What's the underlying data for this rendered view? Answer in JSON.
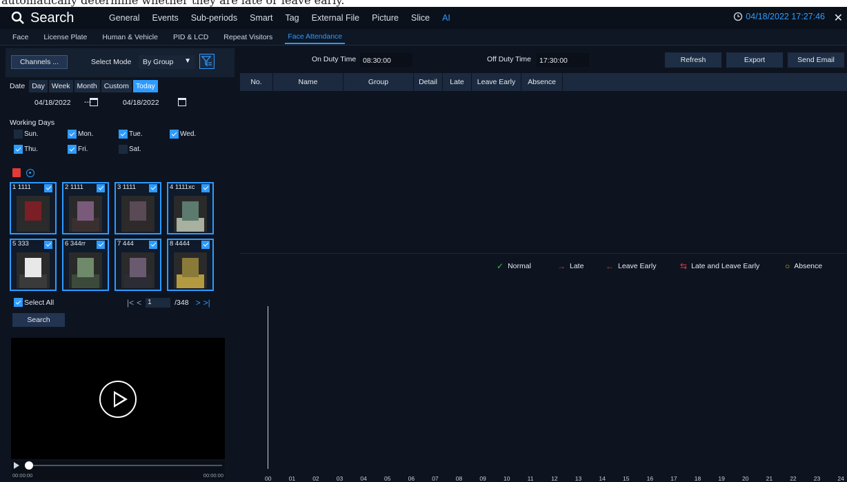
{
  "caption": "automatically determine whether they are late or leave early.",
  "app": {
    "title": "Search",
    "datetime": "04/18/2022 17:27:46",
    "close_symbol": "✕",
    "tabs": [
      "General",
      "Events",
      "Sub-periods",
      "Smart",
      "Tag",
      "External File",
      "Picture",
      "Slice",
      "AI"
    ],
    "active_tab": "AI",
    "accent_color": "#2e9bff"
  },
  "subtabs": {
    "items": [
      "Face",
      "License Plate",
      "Human & Vehicle",
      "PID & LCD",
      "Repeat Visitors",
      "Face Attendance"
    ],
    "active": "Face Attendance"
  },
  "left": {
    "channels_label": "Channels ...",
    "select_mode_label": "Select Mode",
    "select_mode_value": "By Group",
    "date_label": "Date",
    "date_buttons": [
      "Day",
      "Week",
      "Month",
      "Custom",
      "Today"
    ],
    "date_active": "Today",
    "date_from": "04/18/2022",
    "date_sep": "---",
    "date_to": "04/18/2022",
    "working_days_label": "Working Days",
    "days": [
      {
        "label": "Sun.",
        "checked": false
      },
      {
        "label": "Mon.",
        "checked": true
      },
      {
        "label": "Tue.",
        "checked": true
      },
      {
        "label": "Wed.",
        "checked": true
      },
      {
        "label": "Thu.",
        "checked": true
      },
      {
        "label": "Fri.",
        "checked": true
      },
      {
        "label": "Sat.",
        "checked": false
      }
    ],
    "faces": [
      {
        "label": "1 1111",
        "checked": true
      },
      {
        "label": "2 1111",
        "checked": true
      },
      {
        "label": "3 1111",
        "checked": true
      },
      {
        "label": "4 1111xc",
        "checked": true
      },
      {
        "label": "5 333",
        "checked": true
      },
      {
        "label": "6 344rr",
        "checked": true
      },
      {
        "label": "7 444",
        "checked": true
      },
      {
        "label": "8 4444",
        "checked": true
      }
    ],
    "select_all_label": "Select All",
    "page_current": "1",
    "page_total": "/348",
    "search_label": "Search",
    "video_time_start": "00:00:00",
    "video_time_end": "00:00:00"
  },
  "right": {
    "on_duty_label": "On Duty Time",
    "on_duty_value": "08:30:00",
    "off_duty_label": "Off Duty Time",
    "off_duty_value": "17:30:00",
    "refresh_label": "Refresh",
    "export_label": "Export",
    "send_email_label": "Send Email",
    "columns": [
      "No.",
      "Name",
      "Group",
      "Detail",
      "Late",
      "Leave Early",
      "Absence"
    ],
    "legend": [
      {
        "symbol": "✓",
        "label": "Normal",
        "color": "#3cc43c"
      },
      {
        "symbol": "→",
        "label": "Late",
        "color": "#e53935"
      },
      {
        "symbol": "←",
        "label": "Leave Early",
        "color": "#e53935"
      },
      {
        "symbol": "⇆",
        "label": "Late and Leave Early",
        "color": "#e53935"
      },
      {
        "symbol": "○",
        "label": "Absence",
        "color": "#e0b000"
      }
    ],
    "hours": [
      "00",
      "01",
      "02",
      "03",
      "04",
      "05",
      "06",
      "07",
      "08",
      "09",
      "10",
      "11",
      "12",
      "13",
      "14",
      "15",
      "16",
      "17",
      "18",
      "19",
      "20",
      "21",
      "22",
      "23",
      "24"
    ]
  }
}
